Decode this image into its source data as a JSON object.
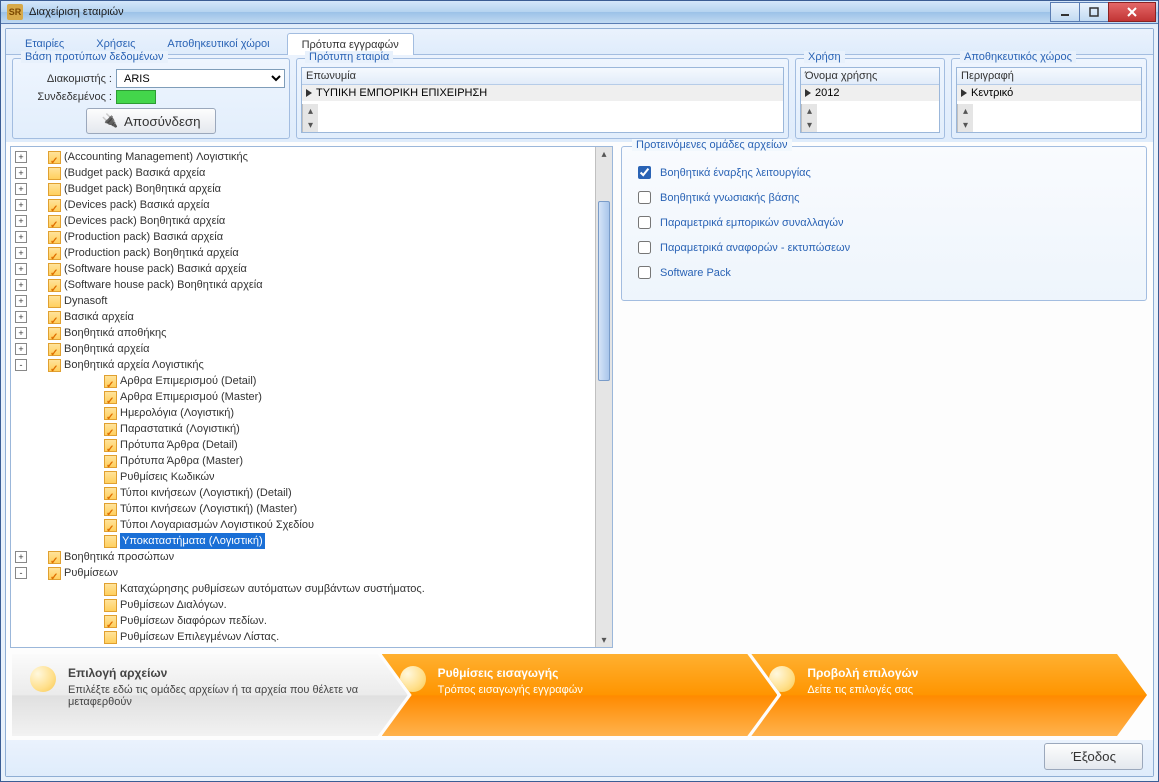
{
  "window": {
    "title": "Διαχείριση εταιριών",
    "icon": "SR"
  },
  "tabs": [
    "Εταιρίες",
    "Χρήσεις",
    "Αποθηκευτικοί χώροι",
    "Πρότυπα εγγραφών"
  ],
  "activeTab": 3,
  "db": {
    "legend": "Βάση προτύπων δεδομένων",
    "server_label": "Διακομιστής :",
    "server_value": "ARIS",
    "connected_label": "Συνδεδεμένος :",
    "btn": "Αποσύνδεση"
  },
  "company": {
    "legend": "Πρότυπη εταιρία",
    "col": "Επωνυμία",
    "row": "ΤΥΠΙΚΗ ΕΜΠΟΡΙΚΗ ΕΠΙΧΕΙΡΗΣΗ"
  },
  "use": {
    "legend": "Χρήση",
    "col": "Όνομα χρήσης",
    "row": "2012"
  },
  "store": {
    "legend": "Αποθηκευτικός χώρος",
    "col": "Περιγραφή",
    "row": "Κεντρικό"
  },
  "tree": [
    {
      "d": 0,
      "e": "+",
      "c": true,
      "t": "(Accounting Management) Λογιστικής"
    },
    {
      "d": 0,
      "e": "+",
      "c": false,
      "t": "(Budget pack) Βασικά αρχεία"
    },
    {
      "d": 0,
      "e": "+",
      "c": false,
      "t": "(Budget pack) Βοηθητικά αρχεία"
    },
    {
      "d": 0,
      "e": "+",
      "c": true,
      "t": "(Devices pack) Βασικά αρχεία"
    },
    {
      "d": 0,
      "e": "+",
      "c": true,
      "t": "(Devices pack) Βοηθητικά αρχεία"
    },
    {
      "d": 0,
      "e": "+",
      "c": true,
      "t": "(Production pack) Βασικά αρχεία"
    },
    {
      "d": 0,
      "e": "+",
      "c": true,
      "t": "(Production pack) Βοηθητικά αρχεία"
    },
    {
      "d": 0,
      "e": "+",
      "c": true,
      "t": "(Software house pack) Βασικά αρχεία"
    },
    {
      "d": 0,
      "e": "+",
      "c": true,
      "t": "(Software house pack) Βοηθητικά αρχεία"
    },
    {
      "d": 0,
      "e": "+",
      "c": false,
      "t": "Dynasoft"
    },
    {
      "d": 0,
      "e": "+",
      "c": true,
      "t": "Βασικά αρχεία"
    },
    {
      "d": 0,
      "e": "+",
      "c": true,
      "t": "Βοηθητικά αποθήκης"
    },
    {
      "d": 0,
      "e": "+",
      "c": true,
      "t": "Βοηθητικά αρχεία"
    },
    {
      "d": 0,
      "e": "-",
      "c": true,
      "t": "Βοηθητικά αρχεία Λογιστικής"
    },
    {
      "d": 1,
      "e": "",
      "c": true,
      "t": "Αρθρα Επιμερισμού (Detail)"
    },
    {
      "d": 1,
      "e": "",
      "c": true,
      "t": "Αρθρα Επιμερισμού (Master)"
    },
    {
      "d": 1,
      "e": "",
      "c": true,
      "t": "Ημερολόγια (Λογιστική)"
    },
    {
      "d": 1,
      "e": "",
      "c": true,
      "t": "Παραστατικά (Λογιστική)"
    },
    {
      "d": 1,
      "e": "",
      "c": true,
      "t": "Πρότυπα Άρθρα (Detail)"
    },
    {
      "d": 1,
      "e": "",
      "c": true,
      "t": "Πρότυπα Άρθρα (Master)"
    },
    {
      "d": 1,
      "e": "",
      "c": false,
      "t": "Ρυθμίσεις Κωδικών"
    },
    {
      "d": 1,
      "e": "",
      "c": true,
      "t": "Τύποι κινήσεων (Λογιστική) (Detail)"
    },
    {
      "d": 1,
      "e": "",
      "c": true,
      "t": "Τύποι κινήσεων (Λογιστική) (Master)"
    },
    {
      "d": 1,
      "e": "",
      "c": true,
      "t": "Τύποι Λογαριασμών Λογιστικού Σχεδίου"
    },
    {
      "d": 1,
      "e": "",
      "c": false,
      "t": "Υποκαταστήματα (Λογιστική)",
      "sel": true
    },
    {
      "d": 0,
      "e": "+",
      "c": true,
      "t": "Βοηθητικά προσώπων"
    },
    {
      "d": 0,
      "e": "-",
      "c": true,
      "t": "Ρυθμίσεων"
    },
    {
      "d": 1,
      "e": "",
      "c": false,
      "t": "Καταχώρησης ρυθμίσεων αυτόματων συμβάντων συστήματος."
    },
    {
      "d": 1,
      "e": "",
      "c": false,
      "t": "Ρυθμίσεων Διαλόγων."
    },
    {
      "d": 1,
      "e": "",
      "c": true,
      "t": "Ρυθμίσεων διαφόρων πεδίων."
    },
    {
      "d": 1,
      "e": "",
      "c": false,
      "t": "Ρυθμίσεων Επιλεγμένων Λίστας."
    }
  ],
  "groups": {
    "legend": "Προτεινόμενες ομάδες αρχείων",
    "items": [
      {
        "c": true,
        "t": "Βοηθητικά έναρξης λειτουργίας"
      },
      {
        "c": false,
        "t": "Βοηθητικά γνωσιακής βάσης"
      },
      {
        "c": false,
        "t": "Παραμετρικά εμπορικών συναλλαγών"
      },
      {
        "c": false,
        "t": "Παραμετρικά αναφορών - εκτυπώσεων"
      },
      {
        "c": false,
        "t": "Software Pack"
      }
    ]
  },
  "wizard": [
    {
      "t": "Επιλογή αρχείων",
      "d": "Επιλέξτε εδώ τις ομάδες αρχείων ή τα αρχεία που θέλετε να μεταφερθούν",
      "active": true
    },
    {
      "t": "Ρυθμίσεις εισαγωγής",
      "d": "Τρόπος εισαγωγής εγγραφών",
      "active": false
    },
    {
      "t": "Προβολή επιλογών",
      "d": "Δείτε τις επιλογές σας",
      "active": false
    }
  ],
  "footer": {
    "exit": "Έξοδος"
  }
}
